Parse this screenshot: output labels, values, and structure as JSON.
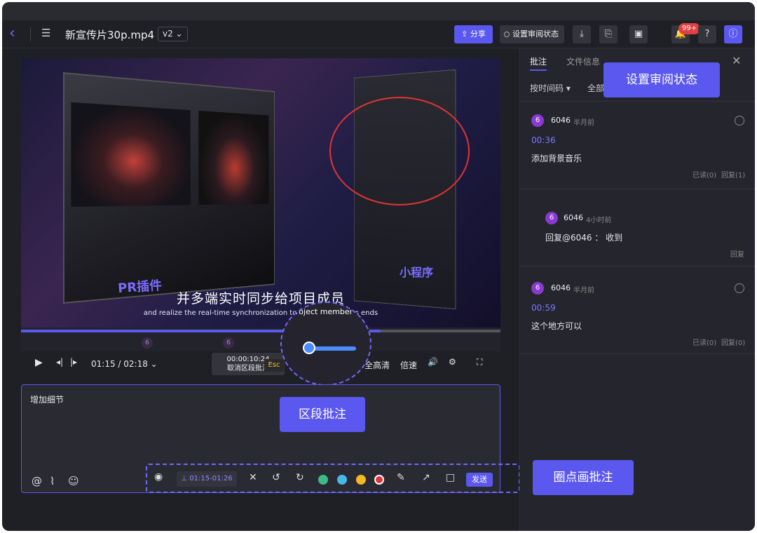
{
  "header": {
    "file_title": "新宣传片30p.mp4",
    "version": "v2 ⌄",
    "share_label": "分享",
    "status_label": "设置审阅状态",
    "notification_badge": "99+",
    "help_label": "?"
  },
  "video": {
    "plugin_label": "PR插件",
    "miniprogram_label": "小程序",
    "subtitle_cn": "并多端实时同步给项目成员",
    "subtitle_en": "and realize the real-time synchronization to project members ends",
    "markers": [
      "6",
      "6"
    ]
  },
  "controls": {
    "timecode": "01:15 / 02:18 ⌄",
    "segment_time": "00:00:10:24",
    "segment_cancel": "取消区段批注",
    "esc": "Esc",
    "quality": "全高清",
    "speed": "倍速"
  },
  "lens": {
    "text": "roject member"
  },
  "editor": {
    "text": "增加细节",
    "time_range": "01:15-01:26",
    "send_label": "发送",
    "colors": [
      "#3dbb84",
      "#47b8e8",
      "#f2b926",
      "#e03434"
    ]
  },
  "panel": {
    "tabs": [
      "批注",
      "文件信息"
    ],
    "filter_time": "按时间码 ▾",
    "filter_all": "全部",
    "comments": [
      {
        "avatar": "6",
        "author": "6046",
        "when": "半月前",
        "time": "00:36",
        "text": "添加背景音乐",
        "read": "已读(0)",
        "reply": "回复(1)"
      },
      {
        "avatar": "6",
        "author": "6046",
        "when": "4小时前",
        "text": "回复@6046 ： 收到",
        "reply": "回复"
      },
      {
        "avatar": "6",
        "author": "6046",
        "when": "半月前",
        "time": "00:59",
        "text": "这个地方可以",
        "read": "已读(0)",
        "reply": "回复(0)"
      }
    ]
  },
  "callouts": {
    "status": "设置审阅状态",
    "segment": "区段批注",
    "draw": "圈点画批注"
  }
}
